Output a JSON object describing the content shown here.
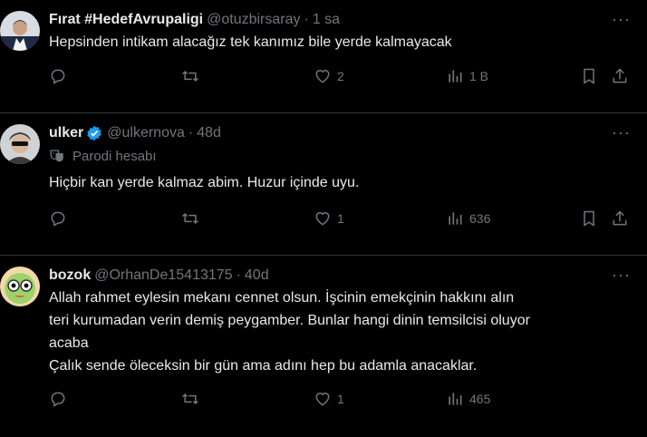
{
  "tweets": [
    {
      "name": "Fırat #HedefAvrupaligi",
      "handle": "@otuzbirsaray",
      "dot": "·",
      "time": "1 sa",
      "verified": false,
      "parody": "",
      "text": [
        "Hepsinden intikam alacağız tek kanımız bile yerde kalmayacak"
      ],
      "likes": "2",
      "views": "1 B",
      "retweets": "",
      "replies": ""
    },
    {
      "name": "ulker",
      "handle": "@ulkernova",
      "dot": "·",
      "time": "48d",
      "verified": true,
      "parody": "Parodi hesabı",
      "text": [
        "Hiçbir kan yerde kalmaz abim. Huzur içinde uyu."
      ],
      "likes": "1",
      "views": "636",
      "retweets": "",
      "replies": ""
    },
    {
      "name": "bozok",
      "handle": "@OrhanDe15413175",
      "dot": "·",
      "time": "40d",
      "verified": false,
      "parody": "",
      "text": [
        "Allah rahmet eylesin mekanı cennet olsun. İşcinin emekçinin hakkını alın",
        "teri kurumadan verin demiş peygamber. Bunlar hangi dinin temsilcisi oluyor",
        "acaba",
        "Çalık sende öleceksin bir gün ama adını hep bu adamla anacaklar."
      ],
      "likes": "1",
      "views": "465",
      "retweets": "",
      "replies": ""
    }
  ],
  "icons": {
    "more": "more-horizontal-icon",
    "reply": "reply-icon",
    "retweet": "retweet-icon",
    "like": "heart-icon",
    "views": "views-chart-icon",
    "bookmark": "bookmark-icon",
    "share": "share-icon"
  },
  "colors": {
    "background": "#000000",
    "text": "#e7e9ea",
    "secondary": "#71767b",
    "divider": "#2f3336",
    "verified": "#1d9bf0"
  }
}
